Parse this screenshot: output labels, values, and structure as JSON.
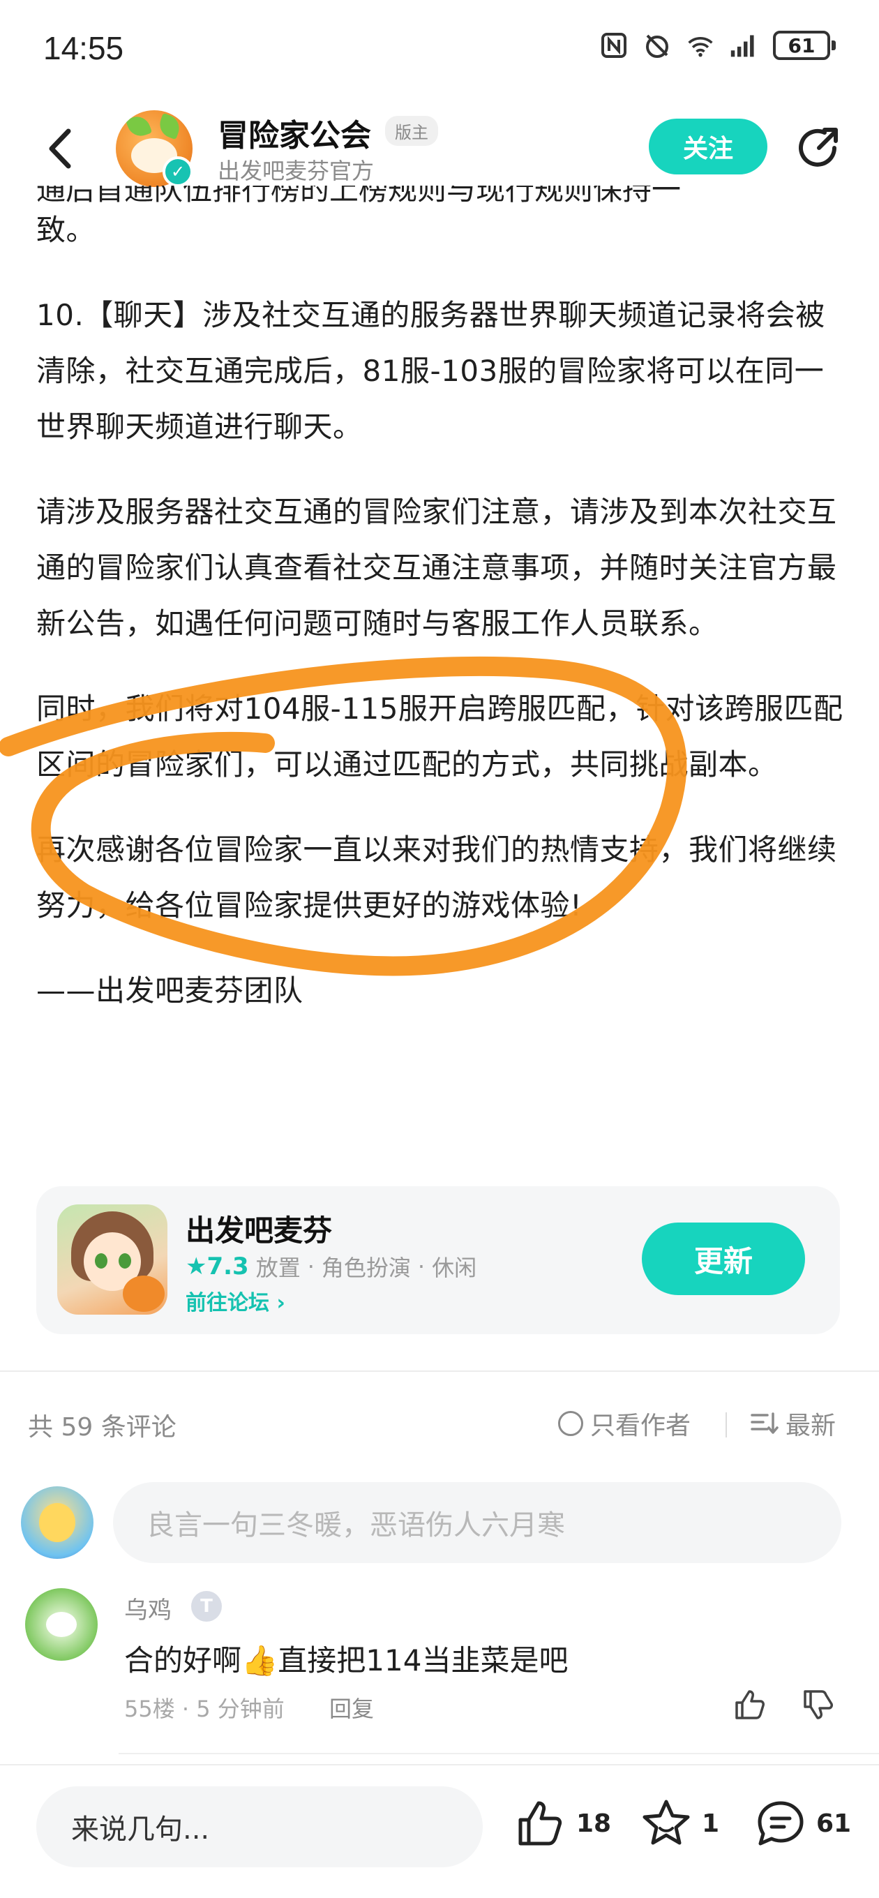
{
  "status_bar": {
    "time": "14:55",
    "battery": "61"
  },
  "header": {
    "title": "冒险家公会",
    "badge": "版主",
    "subtitle": "出发吧麦芬官方",
    "follow_label": "关注"
  },
  "article": {
    "cut_line": "通后首通队伍排行榜的上榜规则与现行规则保持一",
    "paragraphs": [
      "致。",
      "10.【聊天】涉及社交互通的服务器世界聊天频道记录将会被清除，社交互通完成后，81服-103服的冒险家将可以在同一世界聊天频道进行聊天。",
      "请涉及服务器社交互通的冒险家们注意，请涉及到本次社交互通的冒险家们认真查看社交互通注意事项，并随时关注官方最新公告，如遇任何问题可随时与客服工作人员联系。",
      "同时，我们将对104服-115服开启跨服匹配，针对该跨服匹配区间的冒险家们，可以通过匹配的方式，共同挑战副本。",
      "再次感谢各位冒险家一直以来对我们的热情支持，我们将继续努力，给各位冒险家提供更好的游戏体验!",
      "——出发吧麦芬团队"
    ]
  },
  "game_card": {
    "name": "出发吧麦芬",
    "rating": "★7.3",
    "tags": [
      "放置",
      "角色扮演",
      "休闲"
    ],
    "tag_separator": "·",
    "forum_link": "前往论坛 ›",
    "update_label": "更新"
  },
  "comments": {
    "count_label": "共 59 条评论",
    "only_author_label": "只看作者",
    "sort_label": "最新",
    "input_placeholder": "良言一句三冬暖，恶语伤人六月寒",
    "items": [
      {
        "author": "乌鸡",
        "level_badge": "T",
        "text": "合的好啊👍直接把114当韭菜是吧",
        "meta": "55楼 · 5 分钟前",
        "reply_label": "回复"
      }
    ]
  },
  "bottom_bar": {
    "input_placeholder": "来说几句...",
    "likes": "18",
    "favorites": "1",
    "comments": "61"
  },
  "colors": {
    "accent": "#17d4be",
    "highlight_stroke": "#f7931e"
  },
  "icons": [
    "back-icon",
    "share-icon",
    "verified-icon",
    "nfc-icon",
    "dnd-icon",
    "wifi-icon",
    "signal-icon",
    "battery-icon",
    "like-icon",
    "dislike-icon",
    "thumbs-up-icon",
    "star-icon",
    "comment-icon",
    "sort-icon"
  ]
}
